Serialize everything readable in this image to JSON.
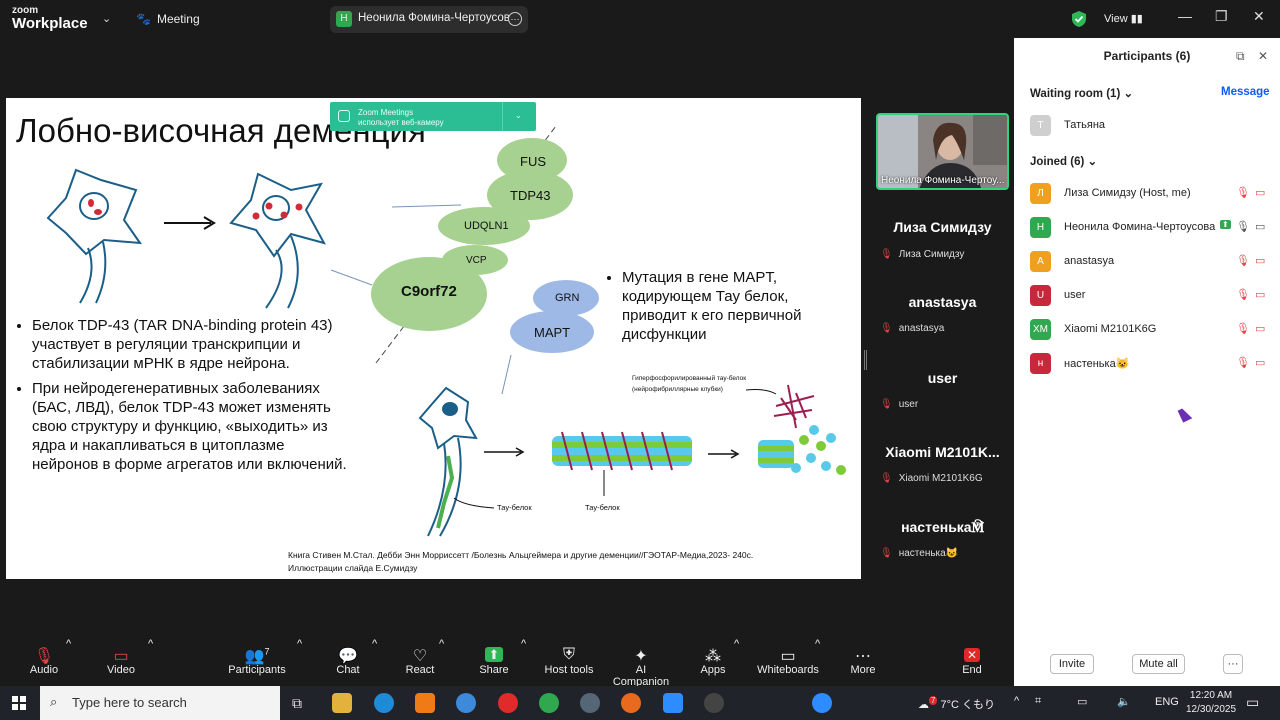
{
  "app": {
    "logo_line1": "zoom",
    "logo_line2": "Workplace",
    "meeting_label": "Meeting",
    "view_label": "View"
  },
  "speaker_pill": {
    "initial": "Н",
    "name": "Неонила Фомина-Чертоусова'"
  },
  "notification": {
    "title": "Zoom Meetings",
    "subtitle": "использует веб-камеру"
  },
  "slide": {
    "title": "Лобно-височная деменция",
    "bullets_left": [
      "Белок TDP-43 (TAR DNA-binding protein 43) участвует в регуляции транскрипции и стабилизации мРНК в  ядре нейрона.",
      "При нейродегенеративных заболеваниях (БАС, ЛВД), белок TDP-43 может изменять свою структуру и функцию, «выходить» из ядра и накапливаться в цитоплазме нейронов в форме агрегатов или включений."
    ],
    "bullet_right": "Мутация в гене MAPT, кодирующем Тау белок, приводит к его  первичной дисфункции",
    "proteins": [
      "FUS",
      "TDP43",
      "UDQLN1",
      "VCP",
      "C9orf72",
      "GRN",
      "MAPT"
    ],
    "tau_label_1": "Тау-белок",
    "tau_label_2": "Тау-белок",
    "hyper_label_1": "Гиперфосфорилированный тау-белок",
    "hyper_label_2": "(нейрофибриллярные клубки)",
    "citation_1": "Книга Стивен М.Стал. Дебби Энн Моррисcетт /Болезнь  Альцгеймера и другие  деменции//ГЭОТАР-Медиа,2023- 240с.",
    "citation_2": "Иллюстрации слайда Е.Сумидзу"
  },
  "video_strip": {
    "self_caption": "Неонила Фомина-Чертоу...",
    "tiles": [
      {
        "big": "Лиза Симидзу",
        "small": "Лиза Симидзу"
      },
      {
        "big": "anastasya",
        "small": "anastasya"
      },
      {
        "big": "user",
        "small": "user"
      },
      {
        "big": "Xiaomi  M2101K...",
        "small": "Xiaomi M2101K6G"
      },
      {
        "big": "настенька🕅",
        "small": "настенька😺"
      }
    ]
  },
  "participants": {
    "title": "Participants (6)",
    "waiting_title": "Waiting room (1)",
    "message_label": "Message",
    "waiting": [
      {
        "initial": "Т",
        "name": "Татьяна",
        "color": "#cfcfcf"
      }
    ],
    "joined_title": "Joined (6)",
    "joined": [
      {
        "initial": "Л",
        "name": "Лиза Симидзу  (Host, me)",
        "color": "#f0a020"
      },
      {
        "initial": "Н",
        "name": "Неонила Фомина-Чертоусова",
        "color": "#2fa84f"
      },
      {
        "initial": "A",
        "name": "anastasya",
        "color": "#f0a020"
      },
      {
        "initial": "U",
        "name": "user",
        "color": "#c8283c"
      },
      {
        "initial": "XM",
        "name": "Xiaomi M2101K6G",
        "color": "#2fa84f"
      },
      {
        "initial": "н",
        "name": "настенька😺",
        "color": "#c8283c"
      }
    ],
    "invite_label": "Invite",
    "mute_all_label": "Mute all",
    "more_label": "···"
  },
  "toolbar": {
    "audio": "Audio",
    "video": "Video",
    "participants": "Participants",
    "participants_count": "7",
    "chat": "Chat",
    "react": "React",
    "share": "Share",
    "host_tools": "Host tools",
    "ai_companion": "AI Companion",
    "apps": "Apps",
    "whiteboards": "Whiteboards",
    "more": "More",
    "end": "End"
  },
  "taskbar": {
    "search_placeholder": "Type here to search",
    "weather": "7°C くもり",
    "weather_badge": "7",
    "lang": "ENG",
    "time": "12:20 AM",
    "date": "12/30/2025"
  },
  "colors": {
    "accent": "#0b5cff",
    "self_border": "#2bd67b",
    "mute_red": "#e04545",
    "toast_green": "#2bbd93"
  }
}
